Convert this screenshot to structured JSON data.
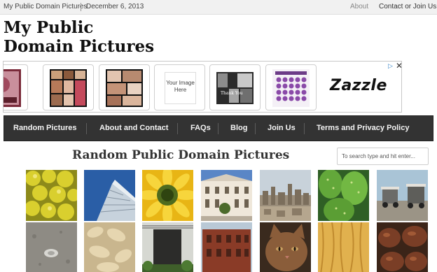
{
  "topbar": {
    "site_link": "My Public Domain Pictures",
    "date": "December 6, 2013",
    "about": "About",
    "contact": "Contact or Join Us"
  },
  "site_title": "My Public Domain Pictures",
  "ad": {
    "your_image_text": "Your Image Here",
    "thank_you_text": "Thank You",
    "brand": "Zazzle",
    "badge_icon": "adchoices-icon",
    "close_icon": "close-icon"
  },
  "nav": {
    "items": [
      "Random Pictures",
      "About and Contact",
      "FAQs",
      "Blog",
      "Join Us",
      "Terms and Privacy Policy"
    ]
  },
  "section": {
    "title": "Random Public Domain Pictures"
  },
  "search": {
    "placeholder": "To search type and hit enter..."
  },
  "pictures": [
    "lemons",
    "glass skyscraper",
    "yellow flower",
    "white building",
    "city skyline",
    "green cactus pads",
    "golf carts",
    "pavement coin",
    "ginger roots",
    "dark doorway",
    "red brick building",
    "brown cat",
    "wood grain",
    "dried fruit"
  ],
  "colors": {
    "nav_background": "#333333",
    "topbar_background": "#f1f1f1",
    "adchoices_blue": "#3a86c8"
  }
}
